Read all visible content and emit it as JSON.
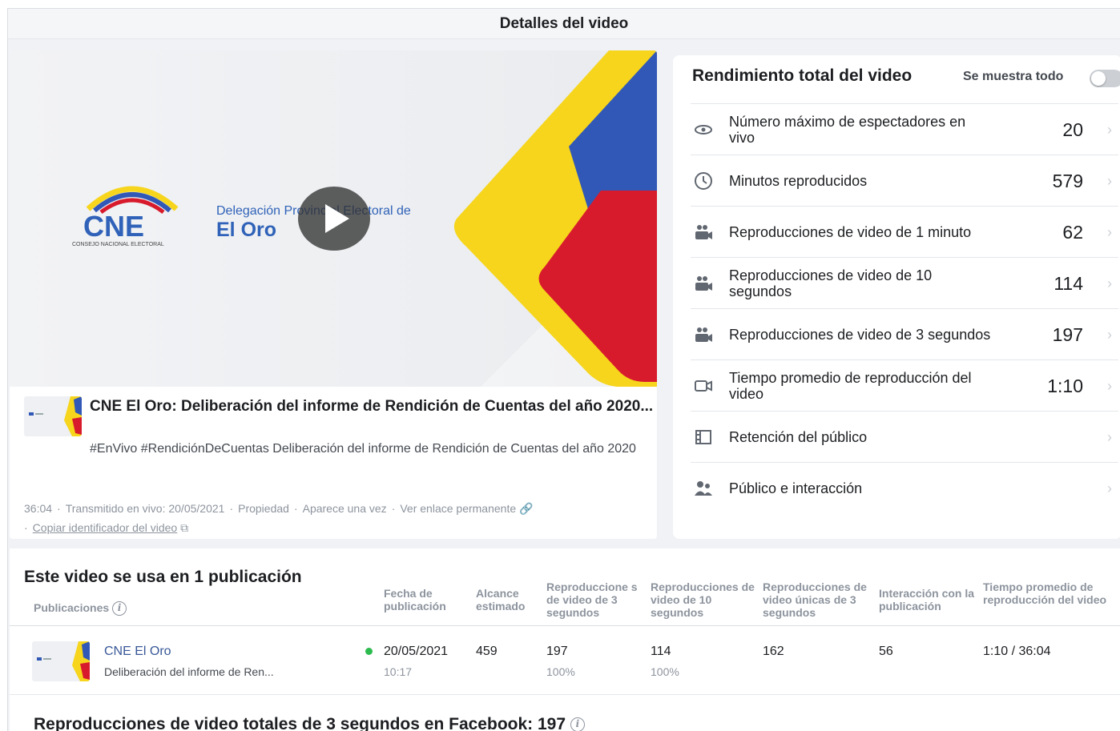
{
  "dialog": {
    "title": "Detalles del video"
  },
  "video": {
    "logo_text": "CNE",
    "logo_subtitle": "CONSEJO NACIONAL ELECTORAL",
    "delegation_line": "Delegación Provincial Electoral de",
    "delegation_place": "El Oro",
    "post_title": "CNE El Oro: Deliberación del informe de Rendición de Cuentas del año 2020...",
    "post_description": "#EnVivo #RendiciónDeCuentas Deliberación del informe de Rendición de Cuentas del año 2020",
    "meta": {
      "duration": "36:04",
      "broadcast": "Transmitido en vivo: 20/05/2021",
      "property": "Propiedad",
      "appears": "Aparece una vez",
      "permalink": "Ver enlace permanente",
      "copy_id": "Copiar identificador del video"
    },
    "colors": {
      "yellow": "#f6d51c",
      "blue": "#3158b6",
      "red": "#d81b2c"
    }
  },
  "performance": {
    "title": "Rendimiento total del video",
    "toggle_label": "Se muestra todo",
    "metrics": [
      {
        "icon": "eye-icon",
        "label": "Número máximo de espectadores en vivo",
        "value": "20"
      },
      {
        "icon": "clock-icon",
        "label": "Minutos reproducidos",
        "value": "579"
      },
      {
        "icon": "audience-video-icon",
        "label": "Reproducciones de video de 1 minuto",
        "value": "62"
      },
      {
        "icon": "audience-video-icon",
        "label": "Reproducciones de video de 10 segundos",
        "value": "114"
      },
      {
        "icon": "audience-video-icon",
        "label": "Reproducciones de video de 3 segundos",
        "value": "197"
      },
      {
        "icon": "video-camera-icon",
        "label": "Tiempo promedio de reproducción del video",
        "value": "1:10"
      },
      {
        "icon": "film-icon",
        "label": "Retención del público",
        "value": ""
      },
      {
        "icon": "people-icon",
        "label": "Público e interacción",
        "value": ""
      }
    ]
  },
  "publications": {
    "title": "Este video se usa en 1 publicación",
    "headers": {
      "publications": "Publicaciones",
      "date": "Fecha de publicación",
      "reach": "Alcance estimado",
      "views3": "Reproduccione s de video de 3 segundos",
      "views10": "Reproducciones de video de 10 segundos",
      "unique3": "Reproducciones de video únicas de 3 segundos",
      "engagement": "Interacción con la publicación",
      "avg_time": "Tiempo promedio de reproducción del video"
    },
    "row": {
      "name": "CNE El Oro",
      "desc": "Deliberación del informe de Ren...",
      "date": "20/05/2021",
      "time": "10:17",
      "reach": "459",
      "views3": "197",
      "views3_pct": "100%",
      "views10": "114",
      "views10_pct": "100%",
      "unique3": "162",
      "engagement": "56",
      "avg_time": "1:10 / 36:04"
    },
    "total": "Reproducciones de video totales de 3 segundos en Facebook: 197"
  }
}
